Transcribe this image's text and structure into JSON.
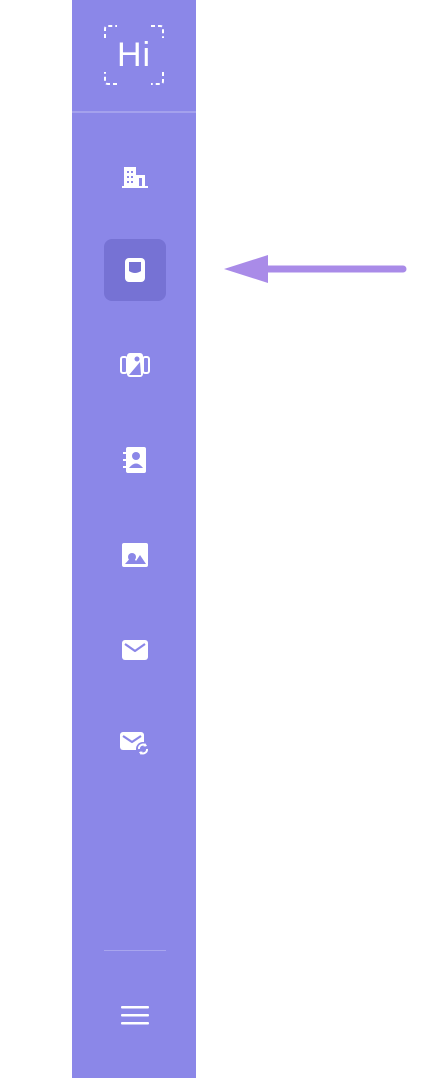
{
  "logo": {
    "text": "Hi"
  },
  "sidebar": {
    "items": [
      {
        "icon": "building-icon",
        "active": false
      },
      {
        "icon": "wallet-icon",
        "active": true
      },
      {
        "icon": "gallery-cards-icon",
        "active": false
      },
      {
        "icon": "contact-book-icon",
        "active": false
      },
      {
        "icon": "image-icon",
        "active": false
      },
      {
        "icon": "mail-icon",
        "active": false
      },
      {
        "icon": "mail-sync-icon",
        "active": false
      }
    ],
    "menu_icon": "hamburger-menu-icon"
  },
  "colors": {
    "sidebar_bg": "#8b87e8",
    "active_bg": "#7672d4",
    "icon": "#ffffff",
    "arrow": "#a98be8"
  }
}
